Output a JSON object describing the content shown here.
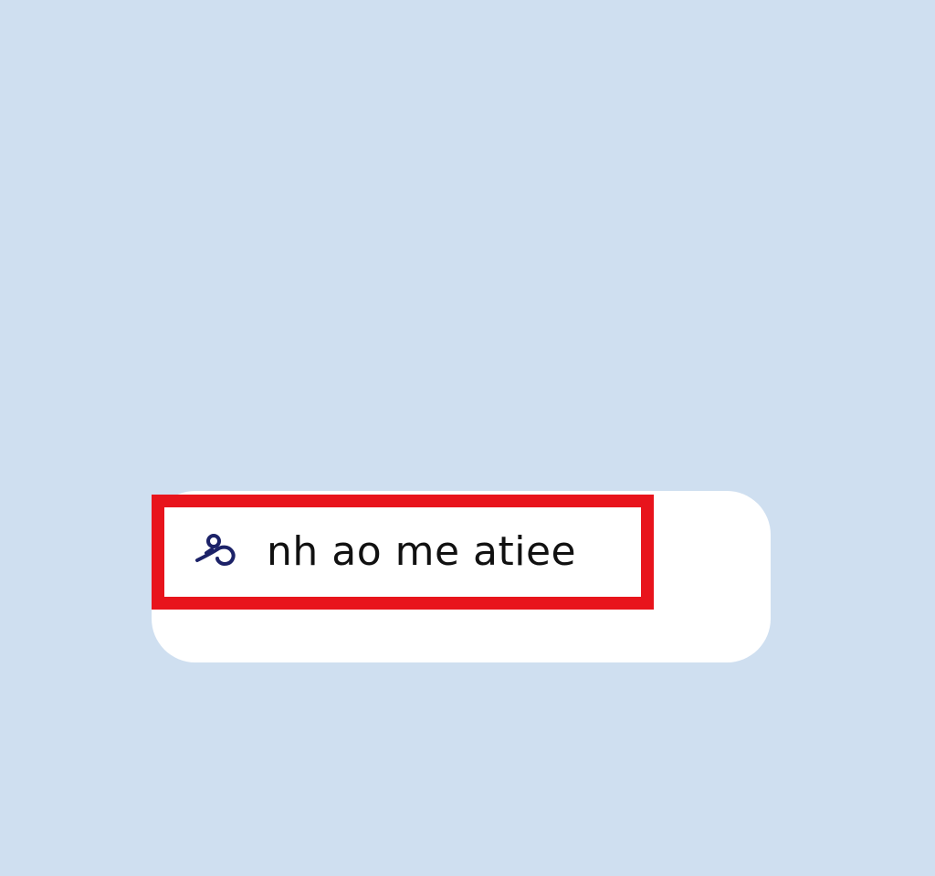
{
  "item": {
    "icon": "link-loop-icon",
    "label": "nh ao me atiee"
  },
  "colors": {
    "background": "#cfdff0",
    "card": "#ffffff",
    "highlight": "#e8141c",
    "icon": "#1c2268",
    "text": "#111111"
  }
}
